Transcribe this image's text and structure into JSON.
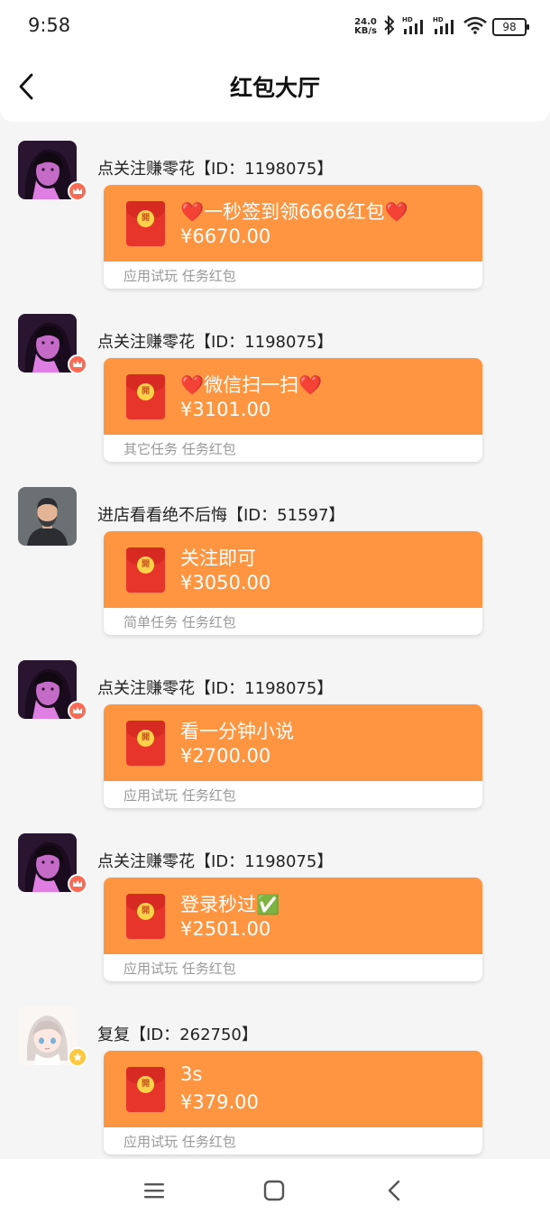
{
  "status_bar": {
    "time": "9:58",
    "net_speed_value": "24.0",
    "net_speed_unit": "KB/s",
    "signal1_label": "HD",
    "signal2_label": "HD",
    "battery": "98",
    "icons": [
      "bluetooth-icon",
      "signal-icon",
      "signal-icon",
      "wifi-icon",
      "battery-icon"
    ]
  },
  "header": {
    "title": "红包大厅",
    "back_icon": "back-arrow-icon"
  },
  "theme": {
    "card_color": "#ff9540",
    "envelope_color": "#e8352b",
    "background": "#f5f5f5"
  },
  "envelope_coin_char": "開",
  "entries": [
    {
      "sender": "点关注赚零花【ID：1198075】",
      "title": "❤️一秒签到领6666红包❤️",
      "amount": "¥6670.00",
      "tags": "应用试玩 任务红包",
      "avatar": "dark-portrait",
      "badge": "red-crown"
    },
    {
      "sender": "点关注赚零花【ID：1198075】",
      "title": "❤️微信扫一扫❤️",
      "amount": "¥3101.00",
      "tags": "其它任务 任务红包",
      "avatar": "dark-portrait",
      "badge": "red-crown"
    },
    {
      "sender": "进店看看绝不后悔【ID：51597】",
      "title": "关注即可",
      "amount": "¥3050.00",
      "tags": "简单任务 任务红包",
      "avatar": "default-user",
      "badge": "none"
    },
    {
      "sender": "点关注赚零花【ID：1198075】",
      "title": "看一分钟小说",
      "amount": "¥2700.00",
      "tags": "应用试玩 任务红包",
      "avatar": "dark-portrait",
      "badge": "red-crown"
    },
    {
      "sender": "点关注赚零花【ID：1198075】",
      "title": "登录秒过✅",
      "amount": "¥2501.00",
      "tags": "应用试玩 任务红包",
      "avatar": "dark-portrait",
      "badge": "red-crown"
    },
    {
      "sender": "复复【ID：262750】",
      "title": "3s",
      "amount": "¥379.00",
      "tags": "应用试玩 任务红包",
      "avatar": "anime-girl",
      "badge": "gold-star"
    }
  ],
  "nav_bar": {
    "buttons": [
      "menu-icon",
      "home-icon",
      "back-icon"
    ]
  }
}
